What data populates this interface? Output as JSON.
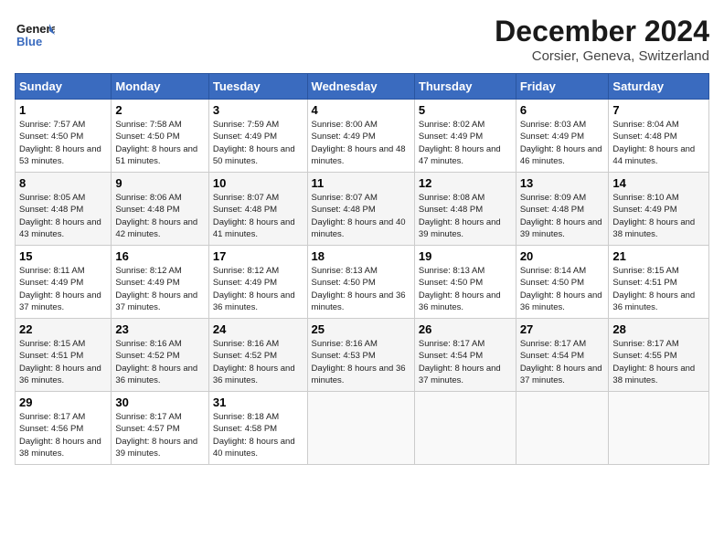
{
  "logo": {
    "text1": "General",
    "text2": "Blue"
  },
  "title": "December 2024",
  "subtitle": "Corsier, Geneva, Switzerland",
  "days_of_week": [
    "Sunday",
    "Monday",
    "Tuesday",
    "Wednesday",
    "Thursday",
    "Friday",
    "Saturday"
  ],
  "weeks": [
    [
      {
        "day": "1",
        "sunrise": "7:57 AM",
        "sunset": "4:50 PM",
        "daylight": "8 hours and 53 minutes."
      },
      {
        "day": "2",
        "sunrise": "7:58 AM",
        "sunset": "4:50 PM",
        "daylight": "8 hours and 51 minutes."
      },
      {
        "day": "3",
        "sunrise": "7:59 AM",
        "sunset": "4:49 PM",
        "daylight": "8 hours and 50 minutes."
      },
      {
        "day": "4",
        "sunrise": "8:00 AM",
        "sunset": "4:49 PM",
        "daylight": "8 hours and 48 minutes."
      },
      {
        "day": "5",
        "sunrise": "8:02 AM",
        "sunset": "4:49 PM",
        "daylight": "8 hours and 47 minutes."
      },
      {
        "day": "6",
        "sunrise": "8:03 AM",
        "sunset": "4:49 PM",
        "daylight": "8 hours and 46 minutes."
      },
      {
        "day": "7",
        "sunrise": "8:04 AM",
        "sunset": "4:48 PM",
        "daylight": "8 hours and 44 minutes."
      }
    ],
    [
      {
        "day": "8",
        "sunrise": "8:05 AM",
        "sunset": "4:48 PM",
        "daylight": "8 hours and 43 minutes."
      },
      {
        "day": "9",
        "sunrise": "8:06 AM",
        "sunset": "4:48 PM",
        "daylight": "8 hours and 42 minutes."
      },
      {
        "day": "10",
        "sunrise": "8:07 AM",
        "sunset": "4:48 PM",
        "daylight": "8 hours and 41 minutes."
      },
      {
        "day": "11",
        "sunrise": "8:07 AM",
        "sunset": "4:48 PM",
        "daylight": "8 hours and 40 minutes."
      },
      {
        "day": "12",
        "sunrise": "8:08 AM",
        "sunset": "4:48 PM",
        "daylight": "8 hours and 39 minutes."
      },
      {
        "day": "13",
        "sunrise": "8:09 AM",
        "sunset": "4:48 PM",
        "daylight": "8 hours and 39 minutes."
      },
      {
        "day": "14",
        "sunrise": "8:10 AM",
        "sunset": "4:49 PM",
        "daylight": "8 hours and 38 minutes."
      }
    ],
    [
      {
        "day": "15",
        "sunrise": "8:11 AM",
        "sunset": "4:49 PM",
        "daylight": "8 hours and 37 minutes."
      },
      {
        "day": "16",
        "sunrise": "8:12 AM",
        "sunset": "4:49 PM",
        "daylight": "8 hours and 37 minutes."
      },
      {
        "day": "17",
        "sunrise": "8:12 AM",
        "sunset": "4:49 PM",
        "daylight": "8 hours and 36 minutes."
      },
      {
        "day": "18",
        "sunrise": "8:13 AM",
        "sunset": "4:50 PM",
        "daylight": "8 hours and 36 minutes."
      },
      {
        "day": "19",
        "sunrise": "8:13 AM",
        "sunset": "4:50 PM",
        "daylight": "8 hours and 36 minutes."
      },
      {
        "day": "20",
        "sunrise": "8:14 AM",
        "sunset": "4:50 PM",
        "daylight": "8 hours and 36 minutes."
      },
      {
        "day": "21",
        "sunrise": "8:15 AM",
        "sunset": "4:51 PM",
        "daylight": "8 hours and 36 minutes."
      }
    ],
    [
      {
        "day": "22",
        "sunrise": "8:15 AM",
        "sunset": "4:51 PM",
        "daylight": "8 hours and 36 minutes."
      },
      {
        "day": "23",
        "sunrise": "8:16 AM",
        "sunset": "4:52 PM",
        "daylight": "8 hours and 36 minutes."
      },
      {
        "day": "24",
        "sunrise": "8:16 AM",
        "sunset": "4:52 PM",
        "daylight": "8 hours and 36 minutes."
      },
      {
        "day": "25",
        "sunrise": "8:16 AM",
        "sunset": "4:53 PM",
        "daylight": "8 hours and 36 minutes."
      },
      {
        "day": "26",
        "sunrise": "8:17 AM",
        "sunset": "4:54 PM",
        "daylight": "8 hours and 37 minutes."
      },
      {
        "day": "27",
        "sunrise": "8:17 AM",
        "sunset": "4:54 PM",
        "daylight": "8 hours and 37 minutes."
      },
      {
        "day": "28",
        "sunrise": "8:17 AM",
        "sunset": "4:55 PM",
        "daylight": "8 hours and 38 minutes."
      }
    ],
    [
      {
        "day": "29",
        "sunrise": "8:17 AM",
        "sunset": "4:56 PM",
        "daylight": "8 hours and 38 minutes."
      },
      {
        "day": "30",
        "sunrise": "8:17 AM",
        "sunset": "4:57 PM",
        "daylight": "8 hours and 39 minutes."
      },
      {
        "day": "31",
        "sunrise": "8:18 AM",
        "sunset": "4:58 PM",
        "daylight": "8 hours and 40 minutes."
      },
      null,
      null,
      null,
      null
    ]
  ]
}
